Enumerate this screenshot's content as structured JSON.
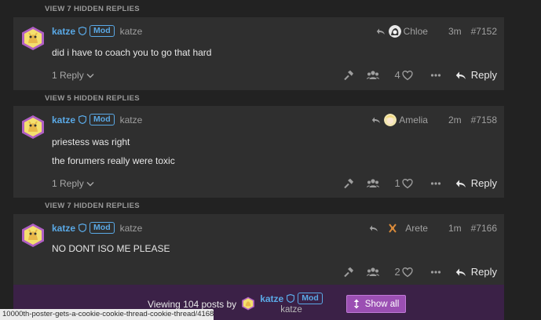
{
  "colors": {
    "page_bg": "#222222",
    "post_bg": "#2f2f2f",
    "username": "#5aa9e6",
    "footer_bg": "#3b2147",
    "show_all_bg": "#9b4fb3"
  },
  "hidden_labels": [
    "VIEW 7 HIDDEN REPLIES",
    "VIEW 5 HIDDEN REPLIES",
    "VIEW 7 HIDDEN REPLIES"
  ],
  "posts": [
    {
      "username": "katze",
      "badge": "Mod",
      "full_name": "katze",
      "reply_to": "Chloe",
      "time": "3m",
      "number": "#7152",
      "lines": [
        "did i have to coach you to go that hard"
      ],
      "replies": "1 Reply",
      "likes": "4",
      "reply_label": "Reply"
    },
    {
      "username": "katze",
      "badge": "Mod",
      "full_name": "katze",
      "reply_to": "Amelia",
      "time": "2m",
      "number": "#7158",
      "lines": [
        "priestess was right",
        "the forumers really were toxic"
      ],
      "replies": "1 Reply",
      "likes": "1",
      "reply_label": "Reply"
    },
    {
      "username": "katze",
      "badge": "Mod",
      "full_name": "katze",
      "reply_to": "Arete",
      "time": "1m",
      "number": "#7166",
      "lines": [
        "NO DONT ISO ME PLEASE"
      ],
      "replies": "",
      "likes": "2",
      "reply_label": "Reply"
    }
  ],
  "footer": {
    "viewing_text": "Viewing 104 posts by",
    "username": "katze",
    "badge": "Mod",
    "full_name": "katze",
    "show_all_label": "Show all"
  },
  "status_url": "10000th-poster-gets-a-cookie-cookie-thread-cookie-thread/4168/7166",
  "icons": [
    "shield-icon",
    "reply-arrow-icon",
    "chevron-down-icon",
    "hammer-icon",
    "users-icon",
    "heart-icon",
    "ellipsis-icon",
    "reply-icon",
    "expand-vertical-icon"
  ]
}
